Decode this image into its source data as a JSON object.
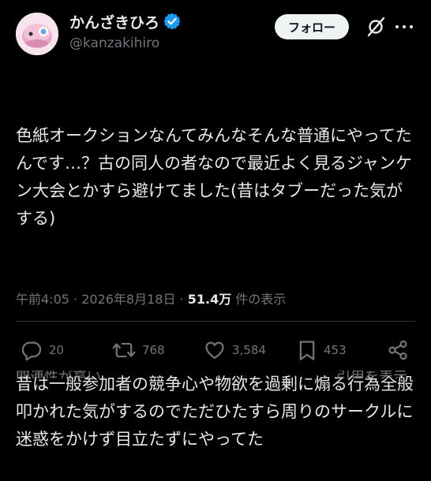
{
  "author": {
    "display_name": "かんざきひろ",
    "handle": "@kanzakihiro",
    "verified": true
  },
  "header": {
    "follow_label": "フォロー"
  },
  "tweet": {
    "paragraph1": "色紙オークションなんてみんなそんな普通にやってたんです…？古の同人の者なので最近よく見るジャンケン大会とかすら避けてました(昔はタブーだった気がする)",
    "paragraph2": "昔は一般参加者の競争心や物欲を過剰に煽る行為全般叩かれた気がするのでただひたすら周りのサークルに迷惑をかけず目立たずにやってた"
  },
  "meta": {
    "time": "午前4:05",
    "separator1": " · ",
    "date": "2026年8月18日",
    "separator2": " · ",
    "views_count": "51.4万",
    "views_label": " 件の表示"
  },
  "actions": {
    "replies": "20",
    "reposts": "768",
    "likes": "3,584",
    "bookmarks": "453"
  },
  "bottom": {
    "left_text": "関連性が高い",
    "right_text": "引用を表示"
  },
  "colors": {
    "background": "#000000",
    "text_primary": "#e7e9ea",
    "text_secondary": "#71767b",
    "verified_blue": "#1d9bf0",
    "follow_bg": "#eff3f4"
  }
}
